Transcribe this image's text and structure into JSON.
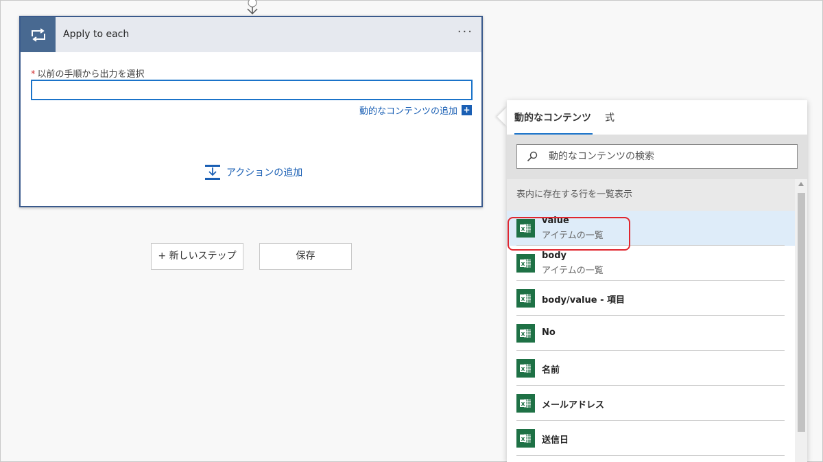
{
  "card": {
    "title": "Apply to each",
    "menu_label": "···",
    "required_mark": "*",
    "field_label": "以前の手順から出力を選択",
    "field_value": "",
    "add_dynamic_label": "動的なコンテンツの追加",
    "add_action_label": "アクションの追加"
  },
  "buttons": {
    "new_step": "+ 新しいステップ",
    "save": "保存"
  },
  "panel": {
    "tabs": [
      {
        "label": "動的なコンテンツ",
        "active": true
      },
      {
        "label": "式",
        "active": false
      }
    ],
    "search_placeholder": "動的なコンテンツの検索",
    "section_title": "表内に存在する行を一覧表示",
    "items": [
      {
        "name": "value",
        "description": "アイテムの一覧",
        "selected": true
      },
      {
        "name": "body",
        "description": "アイテムの一覧",
        "selected": false
      },
      {
        "name": "body/value - 項目",
        "description": "",
        "selected": false
      },
      {
        "name": "No",
        "description": "",
        "selected": false
      },
      {
        "name": "名前",
        "description": "",
        "selected": false
      },
      {
        "name": "メールアドレス",
        "description": "",
        "selected": false
      },
      {
        "name": "送信日",
        "description": "",
        "selected": false
      }
    ]
  },
  "colors": {
    "accent": "#1a73c9",
    "card_border": "#3a5a8c",
    "card_icon_bg": "#486991",
    "excel_green": "#1e7145",
    "highlight_red": "#e0262e",
    "selected_bg": "#deecf9"
  },
  "icons": {
    "card": "loop-icon",
    "item": "excel-icon",
    "search": "search-icon",
    "add_action": "add-action-icon"
  }
}
